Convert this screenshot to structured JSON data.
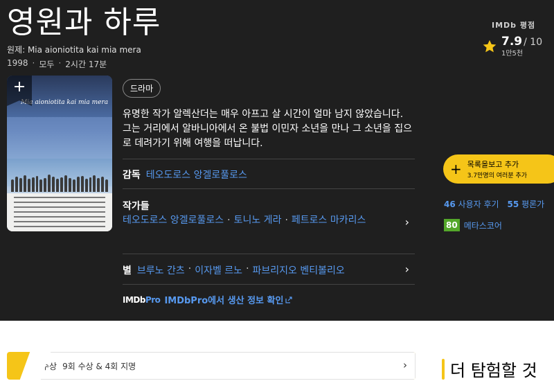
{
  "title": "영원과 하루",
  "original_title": "원제: Mia aioniotita kai mia mera",
  "meta": {
    "year": "1998",
    "rating_cert": "모두",
    "runtime": "2시간 17분",
    "separator": "·"
  },
  "imdb_rating": {
    "label": "IMDb 평점",
    "value": "7.9",
    "max": "/ 10",
    "count": "1만5천"
  },
  "poster": {
    "add_symbol": "+"
  },
  "genre": "드라마",
  "plot": "유명한 작가 알렉산더는 매우 아프고 살 시간이 얼마 남지 않았습니다. 그는 거리에서 알바니아에서 온 불법 이민자 소년을 만나 그 소년을 집으로 데려가기 위해 여행을 떠납니다.",
  "director": {
    "label": "감독",
    "names": [
      "테오도로스 앙겔로풀로스"
    ]
  },
  "writers": {
    "label": "작가들",
    "names": [
      "테오도로스 앙겔로풀로스",
      "토니노 게라",
      "페트로스 마카리스"
    ]
  },
  "stars": {
    "label": "별",
    "names": [
      "브루노 간츠",
      "이자벨 르노",
      "파브리지오 벤티볼리오"
    ]
  },
  "imdbpro": {
    "logo_a": "IMDb",
    "logo_b": "Pro",
    "link": "IMDbPro에서 생산 정보 확인"
  },
  "watchlist": {
    "symbol": "+",
    "label": "목록을보고 추가",
    "sub": "3.7만명의 여러분 추가"
  },
  "reviews": {
    "user_count": "46",
    "user_label": "사용자 후기",
    "critic_count": "55",
    "critic_label": "평론가"
  },
  "metascore": {
    "value": "80",
    "label": "메타스코어"
  },
  "awards": {
    "label": "수상",
    "text": "9회 수상 & 4회 지명"
  },
  "explore": {
    "title": "더 탐험할 것"
  },
  "colors": {
    "accent": "#f5c518",
    "link": "#5799ef",
    "bg": "#1f1f1f",
    "metascore": "#54a72a"
  }
}
